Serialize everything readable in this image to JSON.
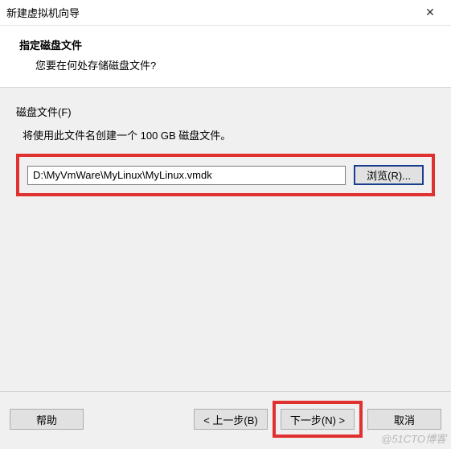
{
  "window": {
    "title": "新建虚拟机向导",
    "close_icon": "✕"
  },
  "header": {
    "title": "指定磁盘文件",
    "subtitle": "您要在何处存储磁盘文件?"
  },
  "disk": {
    "group_label": "磁盘文件(F)",
    "description": "将使用此文件名创建一个 100 GB 磁盘文件。",
    "path_value": "D:\\MyVmWare\\MyLinux\\MyLinux.vmdk",
    "browse_label": "浏览(R)..."
  },
  "footer": {
    "help_label": "帮助",
    "back_label": "< 上一步(B)",
    "next_label": "下一步(N) >",
    "cancel_label": "取消"
  },
  "watermark": "@51CTO博客"
}
